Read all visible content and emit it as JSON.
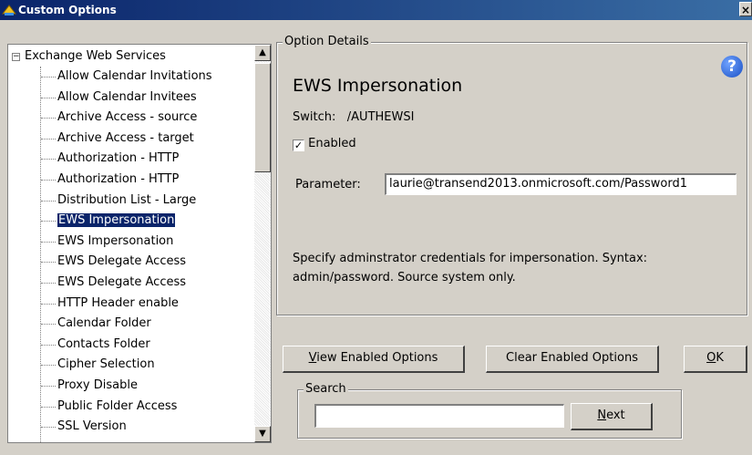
{
  "window": {
    "title": "Custom Options",
    "close_label": "×"
  },
  "tree": {
    "root_label": "Exchange Web Services",
    "expander": "−",
    "items": [
      "Allow Calendar Invitations",
      "Allow Calendar Invitees",
      "Archive Access - source",
      "Archive Access - target",
      "Authorization - HTTP",
      "Authorization - HTTP",
      "Distribution List - Large",
      "EWS Impersonation",
      "EWS Impersonation",
      "EWS Delegate Access",
      "EWS Delegate Access",
      "HTTP Header enable",
      "Calendar Folder",
      "Contacts Folder",
      "Cipher Selection",
      "Proxy Disable",
      "Public Folder Access",
      "SSL Version"
    ],
    "selected_index": 7,
    "scroll_up": "▲",
    "scroll_down": "▼"
  },
  "details": {
    "group_label": "Option Details",
    "help_icon": "?",
    "title": "EWS Impersonation",
    "switch_label": "Switch:",
    "switch_value": "/AUTHEWSI",
    "enabled_label": "Enabled",
    "enabled_checked": true,
    "check_mark": "✓",
    "parameter_label": "Parameter:",
    "parameter_value": "laurie@transend2013.onmicrosoft.com/Password1",
    "description": "Specify adminstrator credentials for impersonation. Syntax: admin/password. Source system only."
  },
  "buttons": {
    "view_enabled": {
      "mnemonic": "V",
      "rest": "iew Enabled Options"
    },
    "clear_enabled": "Clear Enabled Options",
    "ok": {
      "mnemonic": "O",
      "rest": "K"
    }
  },
  "search": {
    "group_label": "Search",
    "value": "",
    "next": {
      "mnemonic": "N",
      "rest": "ext"
    }
  }
}
